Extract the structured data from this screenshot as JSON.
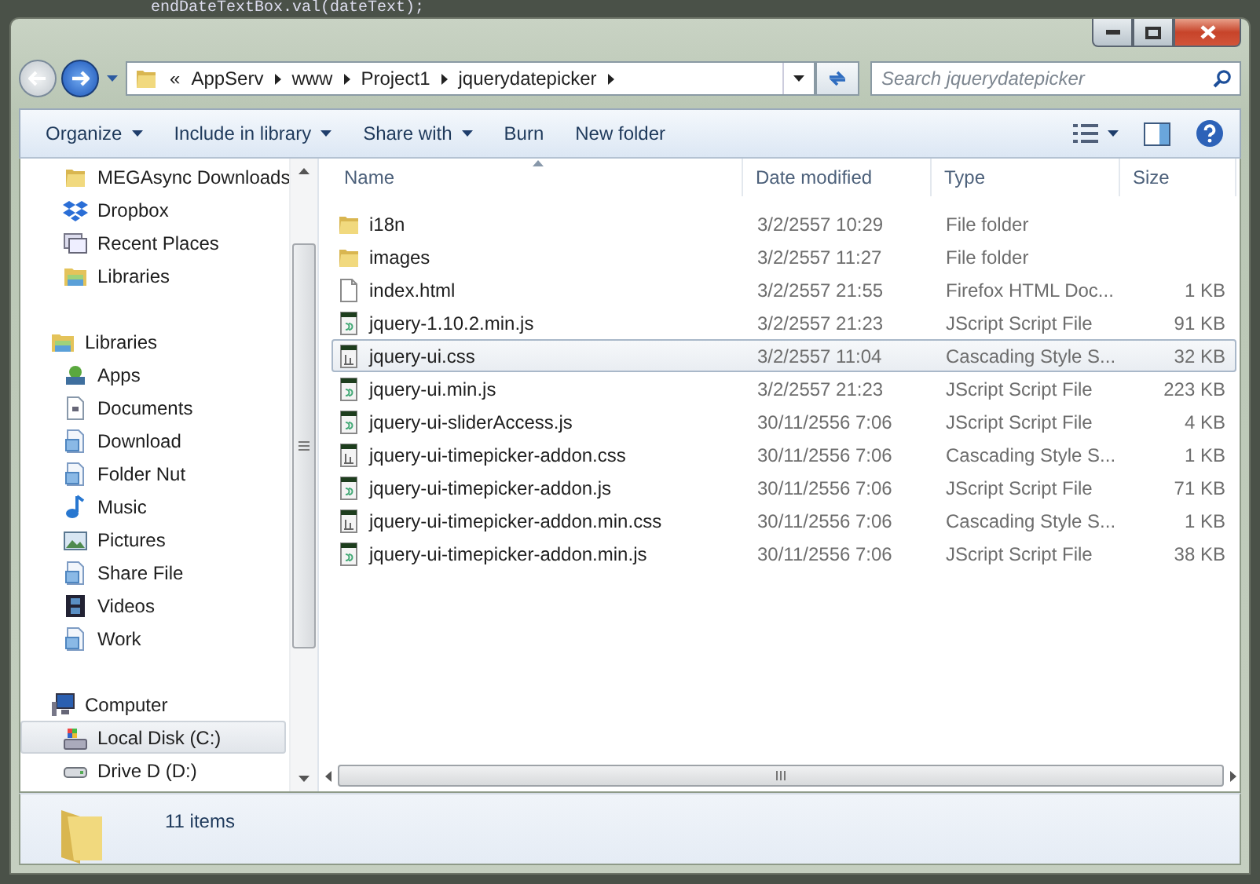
{
  "background_code": "endDateTextBox.val(dateText);",
  "address_bar": {
    "overflow": "«",
    "path": [
      "AppServ",
      "www",
      "Project1",
      "jquerydatepicker"
    ]
  },
  "search": {
    "placeholder": "Search jquerydatepicker"
  },
  "toolbar": {
    "commands": [
      {
        "label": "Organize",
        "dropdown": true
      },
      {
        "label": "Include in library",
        "dropdown": true
      },
      {
        "label": "Share with",
        "dropdown": true
      },
      {
        "label": "Burn",
        "dropdown": false
      },
      {
        "label": "New folder",
        "dropdown": false
      }
    ]
  },
  "sidebar": {
    "items": [
      {
        "label": "MEGAsync Downloads",
        "kind": "folder",
        "selected": false
      },
      {
        "label": "Dropbox",
        "kind": "dropbox",
        "selected": false
      },
      {
        "label": "Recent Places",
        "kind": "recent",
        "selected": false
      },
      {
        "label": "Libraries",
        "kind": "library",
        "selected": false
      }
    ],
    "groups": [
      {
        "label": "Libraries",
        "kind": "library",
        "selected": false,
        "children": [
          {
            "label": "Apps",
            "kind": "apps",
            "selected": false
          },
          {
            "label": "Documents",
            "kind": "document",
            "selected": false
          },
          {
            "label": "Download",
            "kind": "libfolder",
            "selected": false
          },
          {
            "label": "Folder Nut",
            "kind": "libfolder",
            "selected": false
          },
          {
            "label": "Music",
            "kind": "music",
            "selected": false
          },
          {
            "label": "Pictures",
            "kind": "pictures",
            "selected": false
          },
          {
            "label": "Share File",
            "kind": "libfolder",
            "selected": false
          },
          {
            "label": "Videos",
            "kind": "videos",
            "selected": false
          },
          {
            "label": "Work",
            "kind": "libfolder",
            "selected": false
          }
        ]
      },
      {
        "label": "Computer",
        "kind": "computer",
        "selected": false,
        "children": [
          {
            "label": "Local Disk (C:)",
            "kind": "disk",
            "selected": true
          },
          {
            "label": "Drive D (D:)",
            "kind": "drive",
            "selected": false
          }
        ]
      }
    ]
  },
  "file_list": {
    "columns": [
      {
        "label": "Name",
        "sorted": true
      },
      {
        "label": "Date modified",
        "sorted": false
      },
      {
        "label": "Type",
        "sorted": false
      },
      {
        "label": "Size",
        "sorted": false
      }
    ],
    "rows": [
      {
        "name": "i18n",
        "date": "3/2/2557 10:29",
        "type": "File folder",
        "kind": "folder",
        "selected": false
      },
      {
        "name": "images",
        "date": "3/2/2557 11:27",
        "type": "File folder",
        "kind": "folder",
        "selected": false
      },
      {
        "name": "index.html",
        "date": "3/2/2557 21:55",
        "type": "Firefox HTML Doc...",
        "size": "1 KB",
        "kind": "html",
        "selected": false
      },
      {
        "name": "jquery-1.10.2.min.js",
        "date": "3/2/2557 21:23",
        "type": "JScript Script File",
        "size": "91 KB",
        "kind": "script",
        "selected": false
      },
      {
        "name": "jquery-ui.css",
        "date": "3/2/2557 11:04",
        "type": "Cascading Style S...",
        "size": "32 KB",
        "kind": "css",
        "selected": true
      },
      {
        "name": "jquery-ui.min.js",
        "date": "3/2/2557 21:23",
        "type": "JScript Script File",
        "size": "223 KB",
        "kind": "script",
        "selected": false
      },
      {
        "name": "jquery-ui-sliderAccess.js",
        "date": "30/11/2556 7:06",
        "type": "JScript Script File",
        "size": "4 KB",
        "kind": "script",
        "selected": false
      },
      {
        "name": "jquery-ui-timepicker-addon.css",
        "date": "30/11/2556 7:06",
        "type": "Cascading Style S...",
        "size": "1 KB",
        "kind": "css",
        "selected": false
      },
      {
        "name": "jquery-ui-timepicker-addon.js",
        "date": "30/11/2556 7:06",
        "type": "JScript Script File",
        "size": "71 KB",
        "kind": "script",
        "selected": false
      },
      {
        "name": "jquery-ui-timepicker-addon.min.css",
        "date": "30/11/2556 7:06",
        "type": "Cascading Style S...",
        "size": "1 KB",
        "kind": "css",
        "selected": false
      },
      {
        "name": "jquery-ui-timepicker-addon.min.js",
        "date": "30/11/2556 7:06",
        "type": "JScript Script File",
        "size": "38 KB",
        "kind": "script",
        "selected": false
      }
    ]
  },
  "status_bar": {
    "count": "11 items"
  }
}
